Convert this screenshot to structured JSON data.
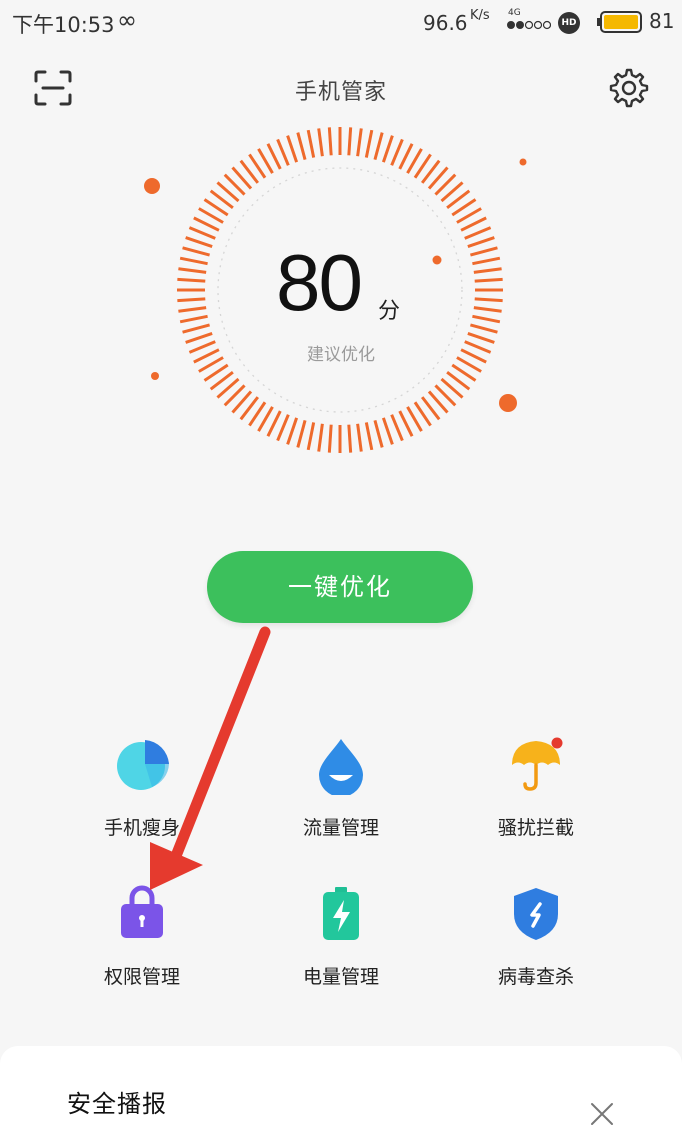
{
  "status_bar": {
    "time": "下午10:53",
    "net_speed": "96.6",
    "net_unit": "K/s",
    "network_type": "4G",
    "hd_badge": "HD",
    "battery": "81"
  },
  "header": {
    "title": "手机管家",
    "scan_icon": "scan-icon",
    "settings_icon": "gear-icon"
  },
  "score": {
    "value": "80",
    "unit": "分",
    "hint": "建议优化"
  },
  "optimize_button": {
    "label": "一键优化"
  },
  "tools": [
    {
      "label": "手机瘦身",
      "icon": "pie-storage-icon"
    },
    {
      "label": "流量管理",
      "icon": "droplet-icon"
    },
    {
      "label": "骚扰拦截",
      "icon": "umbrella-icon"
    },
    {
      "label": "权限管理",
      "icon": "lock-bag-icon"
    },
    {
      "label": "电量管理",
      "icon": "battery-bolt-icon"
    },
    {
      "label": "病毒查杀",
      "icon": "shield-icon"
    }
  ],
  "broadcast": {
    "title": "安全播报",
    "close_icon": "close-icon"
  },
  "colors": {
    "accent_green": "#3cc05c",
    "ring_orange": "#ee6a2c",
    "annotation_red": "#e53a2e"
  }
}
